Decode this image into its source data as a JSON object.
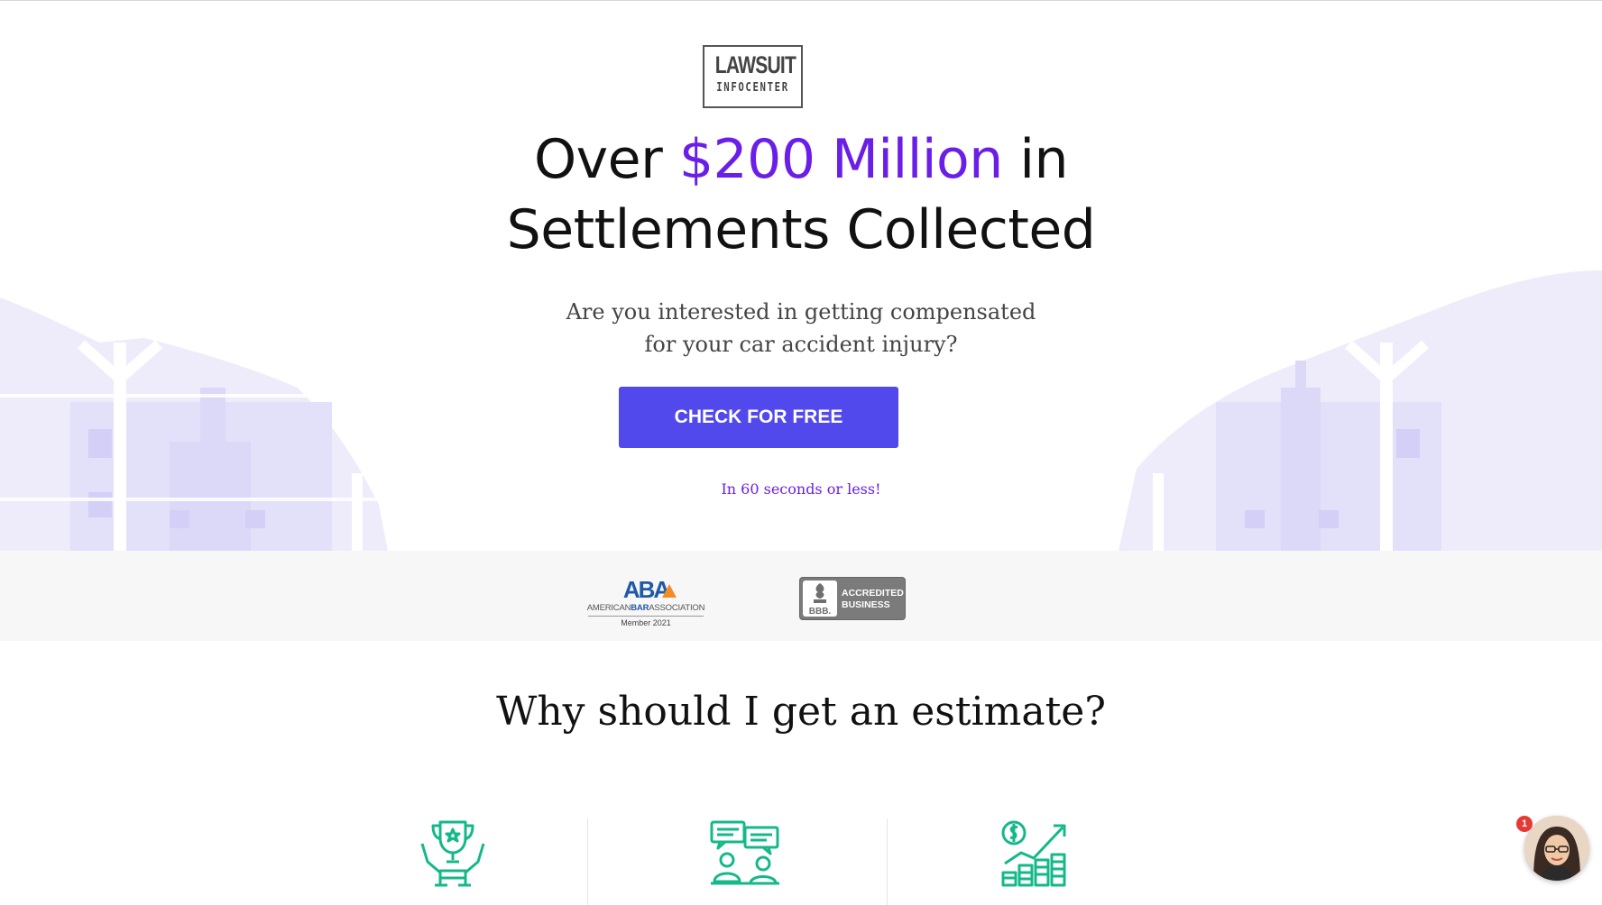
{
  "logo": {
    "line1": "LAWSUIT",
    "line2": "INFOCENTER"
  },
  "hero": {
    "headline_pre": "Over ",
    "headline_accent": "$200 Million",
    "headline_post": " in",
    "headline_line2": "Settlements Collected",
    "subtext_line1": "Are you interested in getting compensated",
    "subtext_line2": "for your car accident injury?",
    "cta_label": "CHECK FOR FREE",
    "note": "In 60 seconds or less!"
  },
  "trust": {
    "aba": {
      "logo_text": "ABA",
      "name_pre": "AMERICAN",
      "name_bold": "BAR",
      "name_post": "ASSOCIATION",
      "member": "Member 2021"
    },
    "bbb": {
      "mark": "BBB.",
      "line1": "ACCREDITED",
      "line2": "BUSINESS"
    }
  },
  "why": {
    "title": "Why should I get an estimate?",
    "features": [
      {
        "icon": "trophy-hands-icon"
      },
      {
        "icon": "consultation-chat-icon"
      },
      {
        "icon": "growth-chart-icon"
      }
    ]
  },
  "chat": {
    "badge_count": "1",
    "icon": "agent-avatar"
  },
  "colors": {
    "accent": "#6a1fe8",
    "cta": "#5249ec",
    "icon_green": "#14b88a",
    "bg_shape": "#e8e6fb"
  }
}
